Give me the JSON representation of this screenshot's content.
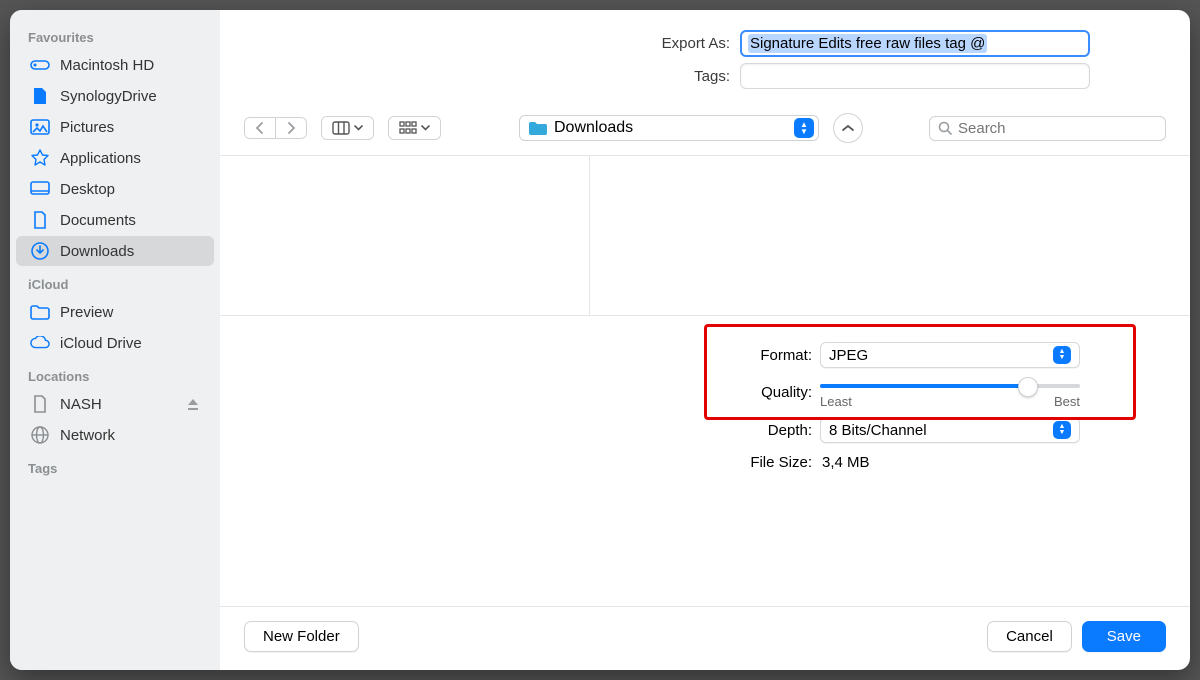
{
  "sidebar": {
    "favourites_head": "Favourites",
    "icloud_head": "iCloud",
    "locations_head": "Locations",
    "tags_head": "Tags",
    "items": {
      "mac": "Macintosh HD",
      "syn": "SynologyDrive",
      "pic": "Pictures",
      "app": "Applications",
      "desk": "Desktop",
      "docs": "Documents",
      "down": "Downloads",
      "prev": "Preview",
      "icd": "iCloud Drive",
      "nash": "NASH",
      "net": "Network"
    }
  },
  "top": {
    "export_label": "Export As:",
    "export_value": "Signature Edits free raw files tag @",
    "tags_label": "Tags:"
  },
  "path": {
    "folder": "Downloads"
  },
  "search": {
    "placeholder": "Search"
  },
  "opts": {
    "format_label": "Format:",
    "format_value": "JPEG",
    "quality_label": "Quality:",
    "quality_least": "Least",
    "quality_best": "Best",
    "depth_label": "Depth:",
    "depth_value": "8 Bits/Channel",
    "filesize_label": "File Size:",
    "filesize_value": "3,4 MB"
  },
  "footer": {
    "newfolder": "New Folder",
    "cancel": "Cancel",
    "save": "Save"
  }
}
